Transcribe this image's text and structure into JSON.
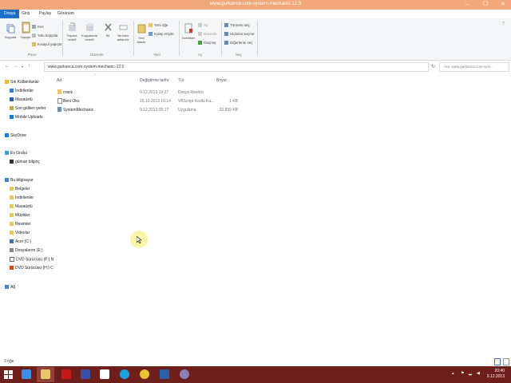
{
  "window": {
    "title": "www.gurkanca.com-system-mechanic-12.5",
    "controls": [
      "–",
      "☐",
      "✕"
    ]
  },
  "ribbon_tabs": [
    "Dosya",
    "Giriş",
    "Paylaş",
    "Görünüm"
  ],
  "ribbon": {
    "pano": {
      "copy": "Kopyala",
      "paste": "Yapıştır",
      "cut": "Kes",
      "copy_path": "Yolu kopyala",
      "paste_shortcut": "Kısayol yapıştır",
      "label": "Pano"
    },
    "organize": {
      "move_to": "Taşıma hedefi",
      "copy_to": "Kopyalama hedefi",
      "delete": "Sil",
      "rename": "Yeniden adlandır",
      "label": "Düzenle"
    },
    "new": {
      "new_folder": "Yeni klasör",
      "new_item": "Yeni öğe",
      "easy_access": "Kolay erişim",
      "label": "Yeni"
    },
    "open": {
      "properties": "Özellikler",
      "open": "Aç",
      "edit": "Düzenle",
      "history": "Geçmiş",
      "label": "Aç"
    },
    "select": {
      "select_all": "Tümünü seç",
      "select_none": "Hiçbirini seçme",
      "invert": "Diğerlerini seç",
      "label": "Seç"
    }
  },
  "address": {
    "path": "www.gurkanca.com-system-mechanic-12.5",
    "search_placeholder": "Ara: www.gurkanca.com-syst..."
  },
  "nav": {
    "favorites": "Sık Kullanılanlar",
    "downloads": "İndirilenler",
    "desktop": "Masaüstü",
    "recent": "Son gidilen yerler",
    "mobile": "Mobile Uploads",
    "skydrive": "SkyDrive",
    "homegroup": "Ev Grubu",
    "homegroup_user": "gürkan bilginç",
    "thispc": "Bu bilgisayar",
    "documents": "Belgeler",
    "pc_downloads": "İndirilenler",
    "pc_desktop": "Masaüstü",
    "music": "Müzikler",
    "pictures": "Resimler",
    "videos": "Videolar",
    "acer": "Acer (C:)",
    "dosyalarim": "Dosyalarım (E:)",
    "dvd_f": "DVD Sürücüsü (F:) N",
    "dvd_h": "DVD Sürücüsü (H:) C",
    "network": "Ağ"
  },
  "columns": {
    "name": "Ad",
    "date": "Değiştirme tarihi",
    "type": "Tür",
    "size": "Boyut"
  },
  "files": [
    {
      "name": "crack",
      "date": "9.12.2013 19:27",
      "type": "Dosya klasörü",
      "size": ""
    },
    {
      "name": "Beni Oku",
      "date": "15.10.2013 16:14",
      "type": "VBScript Kodlu Ka...",
      "size": "1 KB"
    },
    {
      "name": "SystemMechanic",
      "date": "9.12.2013 09:17",
      "type": "Uygulama",
      "size": "33.899 KB"
    }
  ],
  "status": {
    "count": "3 öğe"
  },
  "taskbar": {
    "time": "20:40",
    "date": "9.12.2013"
  }
}
